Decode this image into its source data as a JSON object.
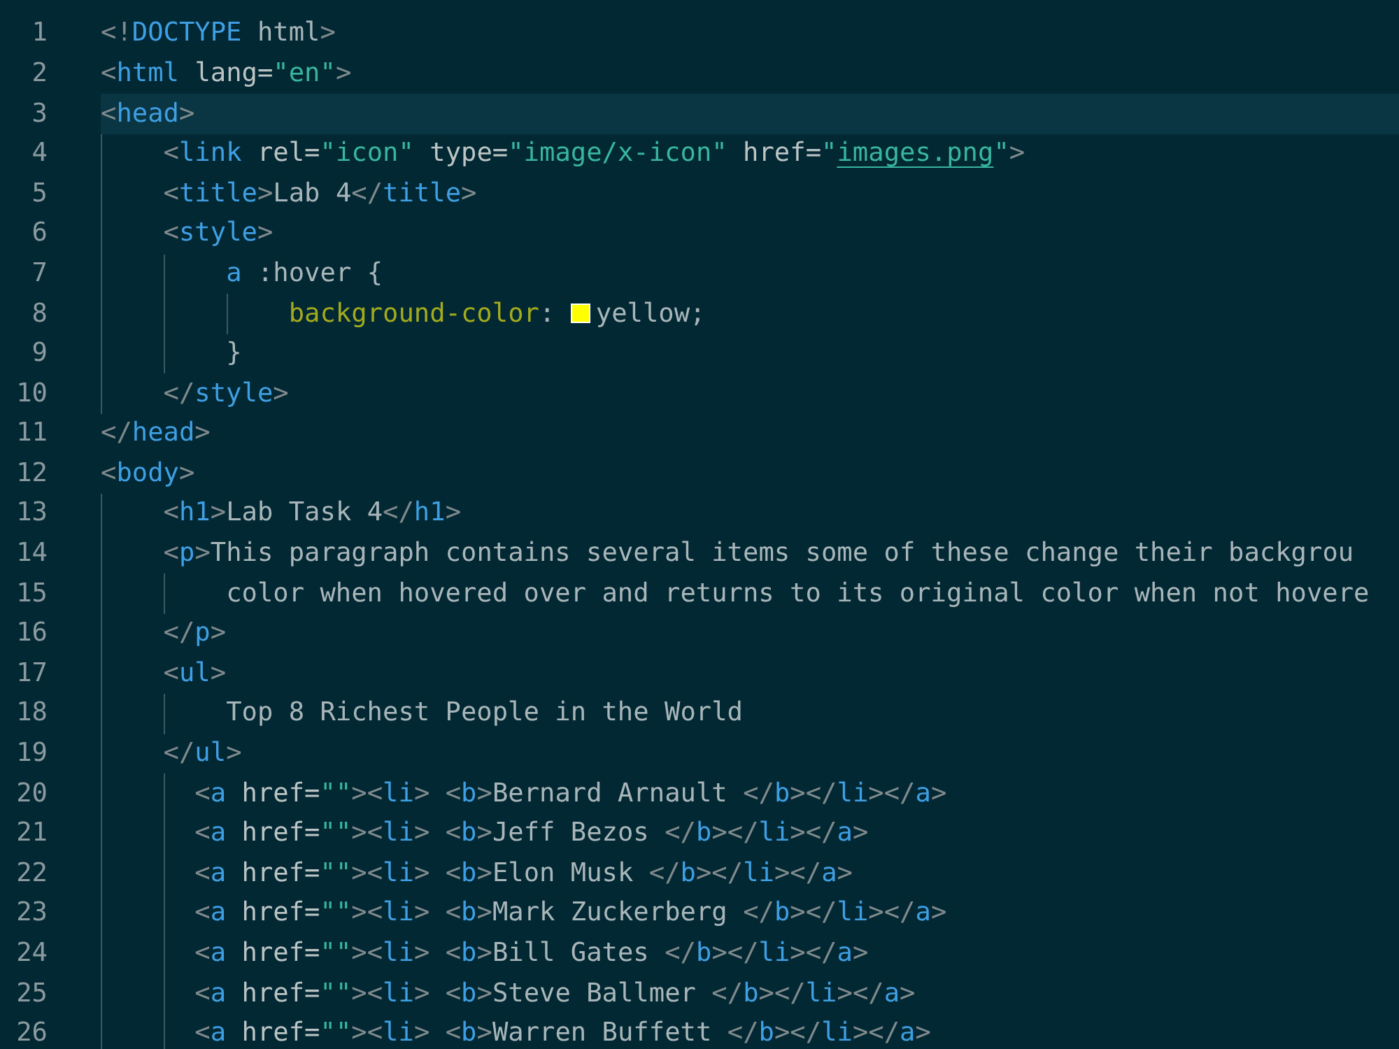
{
  "editor": {
    "lines": [
      {
        "number": "1",
        "current": false,
        "tokens": [
          {
            "kind": "punct",
            "text": "<!"
          },
          {
            "kind": "tag",
            "text": "DOCTYPE"
          },
          {
            "kind": "text",
            "text": " html"
          },
          {
            "kind": "punct",
            "text": ">"
          }
        ]
      },
      {
        "number": "2",
        "current": false,
        "tokens": [
          {
            "kind": "punct",
            "text": "<"
          },
          {
            "kind": "tag",
            "text": "html"
          },
          {
            "kind": "attr",
            "text": " lang="
          },
          {
            "kind": "string",
            "text": "\"en\""
          },
          {
            "kind": "punct",
            "text": ">"
          }
        ]
      },
      {
        "number": "3",
        "current": true,
        "tokens": [
          {
            "kind": "punct",
            "text": "<"
          },
          {
            "kind": "tag",
            "text": "head"
          },
          {
            "kind": "punct",
            "text": ">"
          }
        ]
      },
      {
        "number": "4",
        "current": false,
        "tokens": [
          {
            "kind": "punct",
            "text": "    <"
          },
          {
            "kind": "tag",
            "text": "link"
          },
          {
            "kind": "attr",
            "text": " rel="
          },
          {
            "kind": "string",
            "text": "\"icon\""
          },
          {
            "kind": "attr",
            "text": " type="
          },
          {
            "kind": "string",
            "text": "\"image/x-icon\""
          },
          {
            "kind": "attr",
            "text": " href="
          },
          {
            "kind": "string",
            "text": "\""
          },
          {
            "kind": "link",
            "text": "images.png"
          },
          {
            "kind": "string",
            "text": "\""
          },
          {
            "kind": "punct",
            "text": ">"
          }
        ]
      },
      {
        "number": "5",
        "current": false,
        "tokens": [
          {
            "kind": "punct",
            "text": "    <"
          },
          {
            "kind": "tag",
            "text": "title"
          },
          {
            "kind": "punct",
            "text": ">"
          },
          {
            "kind": "text",
            "text": "Lab 4"
          },
          {
            "kind": "punct",
            "text": "</"
          },
          {
            "kind": "tag",
            "text": "title"
          },
          {
            "kind": "punct",
            "text": ">"
          }
        ]
      },
      {
        "number": "6",
        "current": false,
        "tokens": [
          {
            "kind": "punct",
            "text": "    <"
          },
          {
            "kind": "tag",
            "text": "style"
          },
          {
            "kind": "punct",
            "text": ">"
          }
        ]
      },
      {
        "number": "7",
        "current": false,
        "tokens": [
          {
            "kind": "tag",
            "text": "        a"
          },
          {
            "kind": "text",
            "text": " :hover {"
          }
        ]
      },
      {
        "number": "8",
        "current": false,
        "tokens": [
          {
            "kind": "property",
            "text": "            background-color"
          },
          {
            "kind": "text",
            "text": ":"
          },
          {
            "kind": "swatch",
            "color": "#ffff00"
          },
          {
            "kind": "text",
            "text": "yellow;"
          }
        ]
      },
      {
        "number": "9",
        "current": false,
        "tokens": [
          {
            "kind": "text",
            "text": "        }"
          }
        ]
      },
      {
        "number": "10",
        "current": false,
        "tokens": [
          {
            "kind": "punct",
            "text": "    </"
          },
          {
            "kind": "tag",
            "text": "style"
          },
          {
            "kind": "punct",
            "text": ">"
          }
        ]
      },
      {
        "number": "11",
        "current": false,
        "tokens": [
          {
            "kind": "punct",
            "text": "</"
          },
          {
            "kind": "tag",
            "text": "head"
          },
          {
            "kind": "punct",
            "text": ">"
          }
        ]
      },
      {
        "number": "12",
        "current": false,
        "tokens": [
          {
            "kind": "punct",
            "text": "<"
          },
          {
            "kind": "tag",
            "text": "body"
          },
          {
            "kind": "punct",
            "text": ">"
          }
        ]
      },
      {
        "number": "13",
        "current": false,
        "tokens": [
          {
            "kind": "punct",
            "text": "    <"
          },
          {
            "kind": "tag",
            "text": "h1"
          },
          {
            "kind": "punct",
            "text": ">"
          },
          {
            "kind": "text",
            "text": "Lab Task 4"
          },
          {
            "kind": "punct",
            "text": "</"
          },
          {
            "kind": "tag",
            "text": "h1"
          },
          {
            "kind": "punct",
            "text": ">"
          }
        ]
      },
      {
        "number": "14",
        "current": false,
        "tokens": [
          {
            "kind": "punct",
            "text": "    <"
          },
          {
            "kind": "tag",
            "text": "p"
          },
          {
            "kind": "punct",
            "text": ">"
          },
          {
            "kind": "text",
            "text": "This paragraph contains several items some of these change their backgrou"
          }
        ]
      },
      {
        "number": "15",
        "current": false,
        "tokens": [
          {
            "kind": "text",
            "text": "        color when hovered over and returns to its original color when not hovere"
          }
        ]
      },
      {
        "number": "16",
        "current": false,
        "tokens": [
          {
            "kind": "punct",
            "text": "    </"
          },
          {
            "kind": "tag",
            "text": "p"
          },
          {
            "kind": "punct",
            "text": ">"
          }
        ]
      },
      {
        "number": "17",
        "current": false,
        "tokens": [
          {
            "kind": "punct",
            "text": "    <"
          },
          {
            "kind": "tag",
            "text": "ul"
          },
          {
            "kind": "punct",
            "text": ">"
          }
        ]
      },
      {
        "number": "18",
        "current": false,
        "tokens": [
          {
            "kind": "text",
            "text": "        Top 8 Richest People in the World"
          }
        ]
      },
      {
        "number": "19",
        "current": false,
        "tokens": [
          {
            "kind": "punct",
            "text": "    </"
          },
          {
            "kind": "tag",
            "text": "ul"
          },
          {
            "kind": "punct",
            "text": ">"
          }
        ]
      },
      {
        "number": "20",
        "current": false,
        "tokens": [
          {
            "kind": "punct",
            "text": "      <"
          },
          {
            "kind": "tag",
            "text": "a"
          },
          {
            "kind": "attr",
            "text": " href="
          },
          {
            "kind": "string",
            "text": "\"\""
          },
          {
            "kind": "punct",
            "text": "><"
          },
          {
            "kind": "tag",
            "text": "li"
          },
          {
            "kind": "punct",
            "text": "> <"
          },
          {
            "kind": "tag",
            "text": "b"
          },
          {
            "kind": "punct",
            "text": ">"
          },
          {
            "kind": "text",
            "text": "Bernard Arnault"
          },
          {
            "kind": "punct",
            "text": " </"
          },
          {
            "kind": "tag",
            "text": "b"
          },
          {
            "kind": "punct",
            "text": "></"
          },
          {
            "kind": "tag",
            "text": "li"
          },
          {
            "kind": "punct",
            "text": "></"
          },
          {
            "kind": "tag",
            "text": "a"
          },
          {
            "kind": "punct",
            "text": ">"
          }
        ]
      },
      {
        "number": "21",
        "current": false,
        "tokens": [
          {
            "kind": "punct",
            "text": "      <"
          },
          {
            "kind": "tag",
            "text": "a"
          },
          {
            "kind": "attr",
            "text": " href="
          },
          {
            "kind": "string",
            "text": "\"\""
          },
          {
            "kind": "punct",
            "text": "><"
          },
          {
            "kind": "tag",
            "text": "li"
          },
          {
            "kind": "punct",
            "text": "> <"
          },
          {
            "kind": "tag",
            "text": "b"
          },
          {
            "kind": "punct",
            "text": ">"
          },
          {
            "kind": "text",
            "text": "Jeff Bezos"
          },
          {
            "kind": "punct",
            "text": " </"
          },
          {
            "kind": "tag",
            "text": "b"
          },
          {
            "kind": "punct",
            "text": "></"
          },
          {
            "kind": "tag",
            "text": "li"
          },
          {
            "kind": "punct",
            "text": "></"
          },
          {
            "kind": "tag",
            "text": "a"
          },
          {
            "kind": "punct",
            "text": ">"
          }
        ]
      },
      {
        "number": "22",
        "current": false,
        "tokens": [
          {
            "kind": "punct",
            "text": "      <"
          },
          {
            "kind": "tag",
            "text": "a"
          },
          {
            "kind": "attr",
            "text": " href="
          },
          {
            "kind": "string",
            "text": "\"\""
          },
          {
            "kind": "punct",
            "text": "><"
          },
          {
            "kind": "tag",
            "text": "li"
          },
          {
            "kind": "punct",
            "text": "> <"
          },
          {
            "kind": "tag",
            "text": "b"
          },
          {
            "kind": "punct",
            "text": ">"
          },
          {
            "kind": "text",
            "text": "Elon Musk"
          },
          {
            "kind": "punct",
            "text": " </"
          },
          {
            "kind": "tag",
            "text": "b"
          },
          {
            "kind": "punct",
            "text": "></"
          },
          {
            "kind": "tag",
            "text": "li"
          },
          {
            "kind": "punct",
            "text": "></"
          },
          {
            "kind": "tag",
            "text": "a"
          },
          {
            "kind": "punct",
            "text": ">"
          }
        ]
      },
      {
        "number": "23",
        "current": false,
        "tokens": [
          {
            "kind": "punct",
            "text": "      <"
          },
          {
            "kind": "tag",
            "text": "a"
          },
          {
            "kind": "attr",
            "text": " href="
          },
          {
            "kind": "string",
            "text": "\"\""
          },
          {
            "kind": "punct",
            "text": "><"
          },
          {
            "kind": "tag",
            "text": "li"
          },
          {
            "kind": "punct",
            "text": "> <"
          },
          {
            "kind": "tag",
            "text": "b"
          },
          {
            "kind": "punct",
            "text": ">"
          },
          {
            "kind": "text",
            "text": "Mark Zuckerberg"
          },
          {
            "kind": "punct",
            "text": " </"
          },
          {
            "kind": "tag",
            "text": "b"
          },
          {
            "kind": "punct",
            "text": "></"
          },
          {
            "kind": "tag",
            "text": "li"
          },
          {
            "kind": "punct",
            "text": "></"
          },
          {
            "kind": "tag",
            "text": "a"
          },
          {
            "kind": "punct",
            "text": ">"
          }
        ]
      },
      {
        "number": "24",
        "current": false,
        "tokens": [
          {
            "kind": "punct",
            "text": "      <"
          },
          {
            "kind": "tag",
            "text": "a"
          },
          {
            "kind": "attr",
            "text": " href="
          },
          {
            "kind": "string",
            "text": "\"\""
          },
          {
            "kind": "punct",
            "text": "><"
          },
          {
            "kind": "tag",
            "text": "li"
          },
          {
            "kind": "punct",
            "text": "> <"
          },
          {
            "kind": "tag",
            "text": "b"
          },
          {
            "kind": "punct",
            "text": ">"
          },
          {
            "kind": "text",
            "text": "Bill Gates"
          },
          {
            "kind": "punct",
            "text": " </"
          },
          {
            "kind": "tag",
            "text": "b"
          },
          {
            "kind": "punct",
            "text": "></"
          },
          {
            "kind": "tag",
            "text": "li"
          },
          {
            "kind": "punct",
            "text": "></"
          },
          {
            "kind": "tag",
            "text": "a"
          },
          {
            "kind": "punct",
            "text": ">"
          }
        ]
      },
      {
        "number": "25",
        "current": false,
        "tokens": [
          {
            "kind": "punct",
            "text": "      <"
          },
          {
            "kind": "tag",
            "text": "a"
          },
          {
            "kind": "attr",
            "text": " href="
          },
          {
            "kind": "string",
            "text": "\"\""
          },
          {
            "kind": "punct",
            "text": "><"
          },
          {
            "kind": "tag",
            "text": "li"
          },
          {
            "kind": "punct",
            "text": "> <"
          },
          {
            "kind": "tag",
            "text": "b"
          },
          {
            "kind": "punct",
            "text": ">"
          },
          {
            "kind": "text",
            "text": "Steve Ballmer"
          },
          {
            "kind": "punct",
            "text": " </"
          },
          {
            "kind": "tag",
            "text": "b"
          },
          {
            "kind": "punct",
            "text": "></"
          },
          {
            "kind": "tag",
            "text": "li"
          },
          {
            "kind": "punct",
            "text": "></"
          },
          {
            "kind": "tag",
            "text": "a"
          },
          {
            "kind": "punct",
            "text": ">"
          }
        ]
      },
      {
        "number": "26",
        "current": false,
        "tokens": [
          {
            "kind": "punct",
            "text": "      <"
          },
          {
            "kind": "tag",
            "text": "a"
          },
          {
            "kind": "attr",
            "text": " href="
          },
          {
            "kind": "string",
            "text": "\"\""
          },
          {
            "kind": "punct",
            "text": "><"
          },
          {
            "kind": "tag",
            "text": "li"
          },
          {
            "kind": "punct",
            "text": "> <"
          },
          {
            "kind": "tag",
            "text": "b"
          },
          {
            "kind": "punct",
            "text": ">"
          },
          {
            "kind": "text",
            "text": "Warren Buffett"
          },
          {
            "kind": "punct",
            "text": " </"
          },
          {
            "kind": "tag",
            "text": "b"
          },
          {
            "kind": "punct",
            "text": "></"
          },
          {
            "kind": "tag",
            "text": "li"
          },
          {
            "kind": "punct",
            "text": "></"
          },
          {
            "kind": "tag",
            "text": "a"
          },
          {
            "kind": "punct",
            "text": ">"
          }
        ]
      }
    ]
  }
}
